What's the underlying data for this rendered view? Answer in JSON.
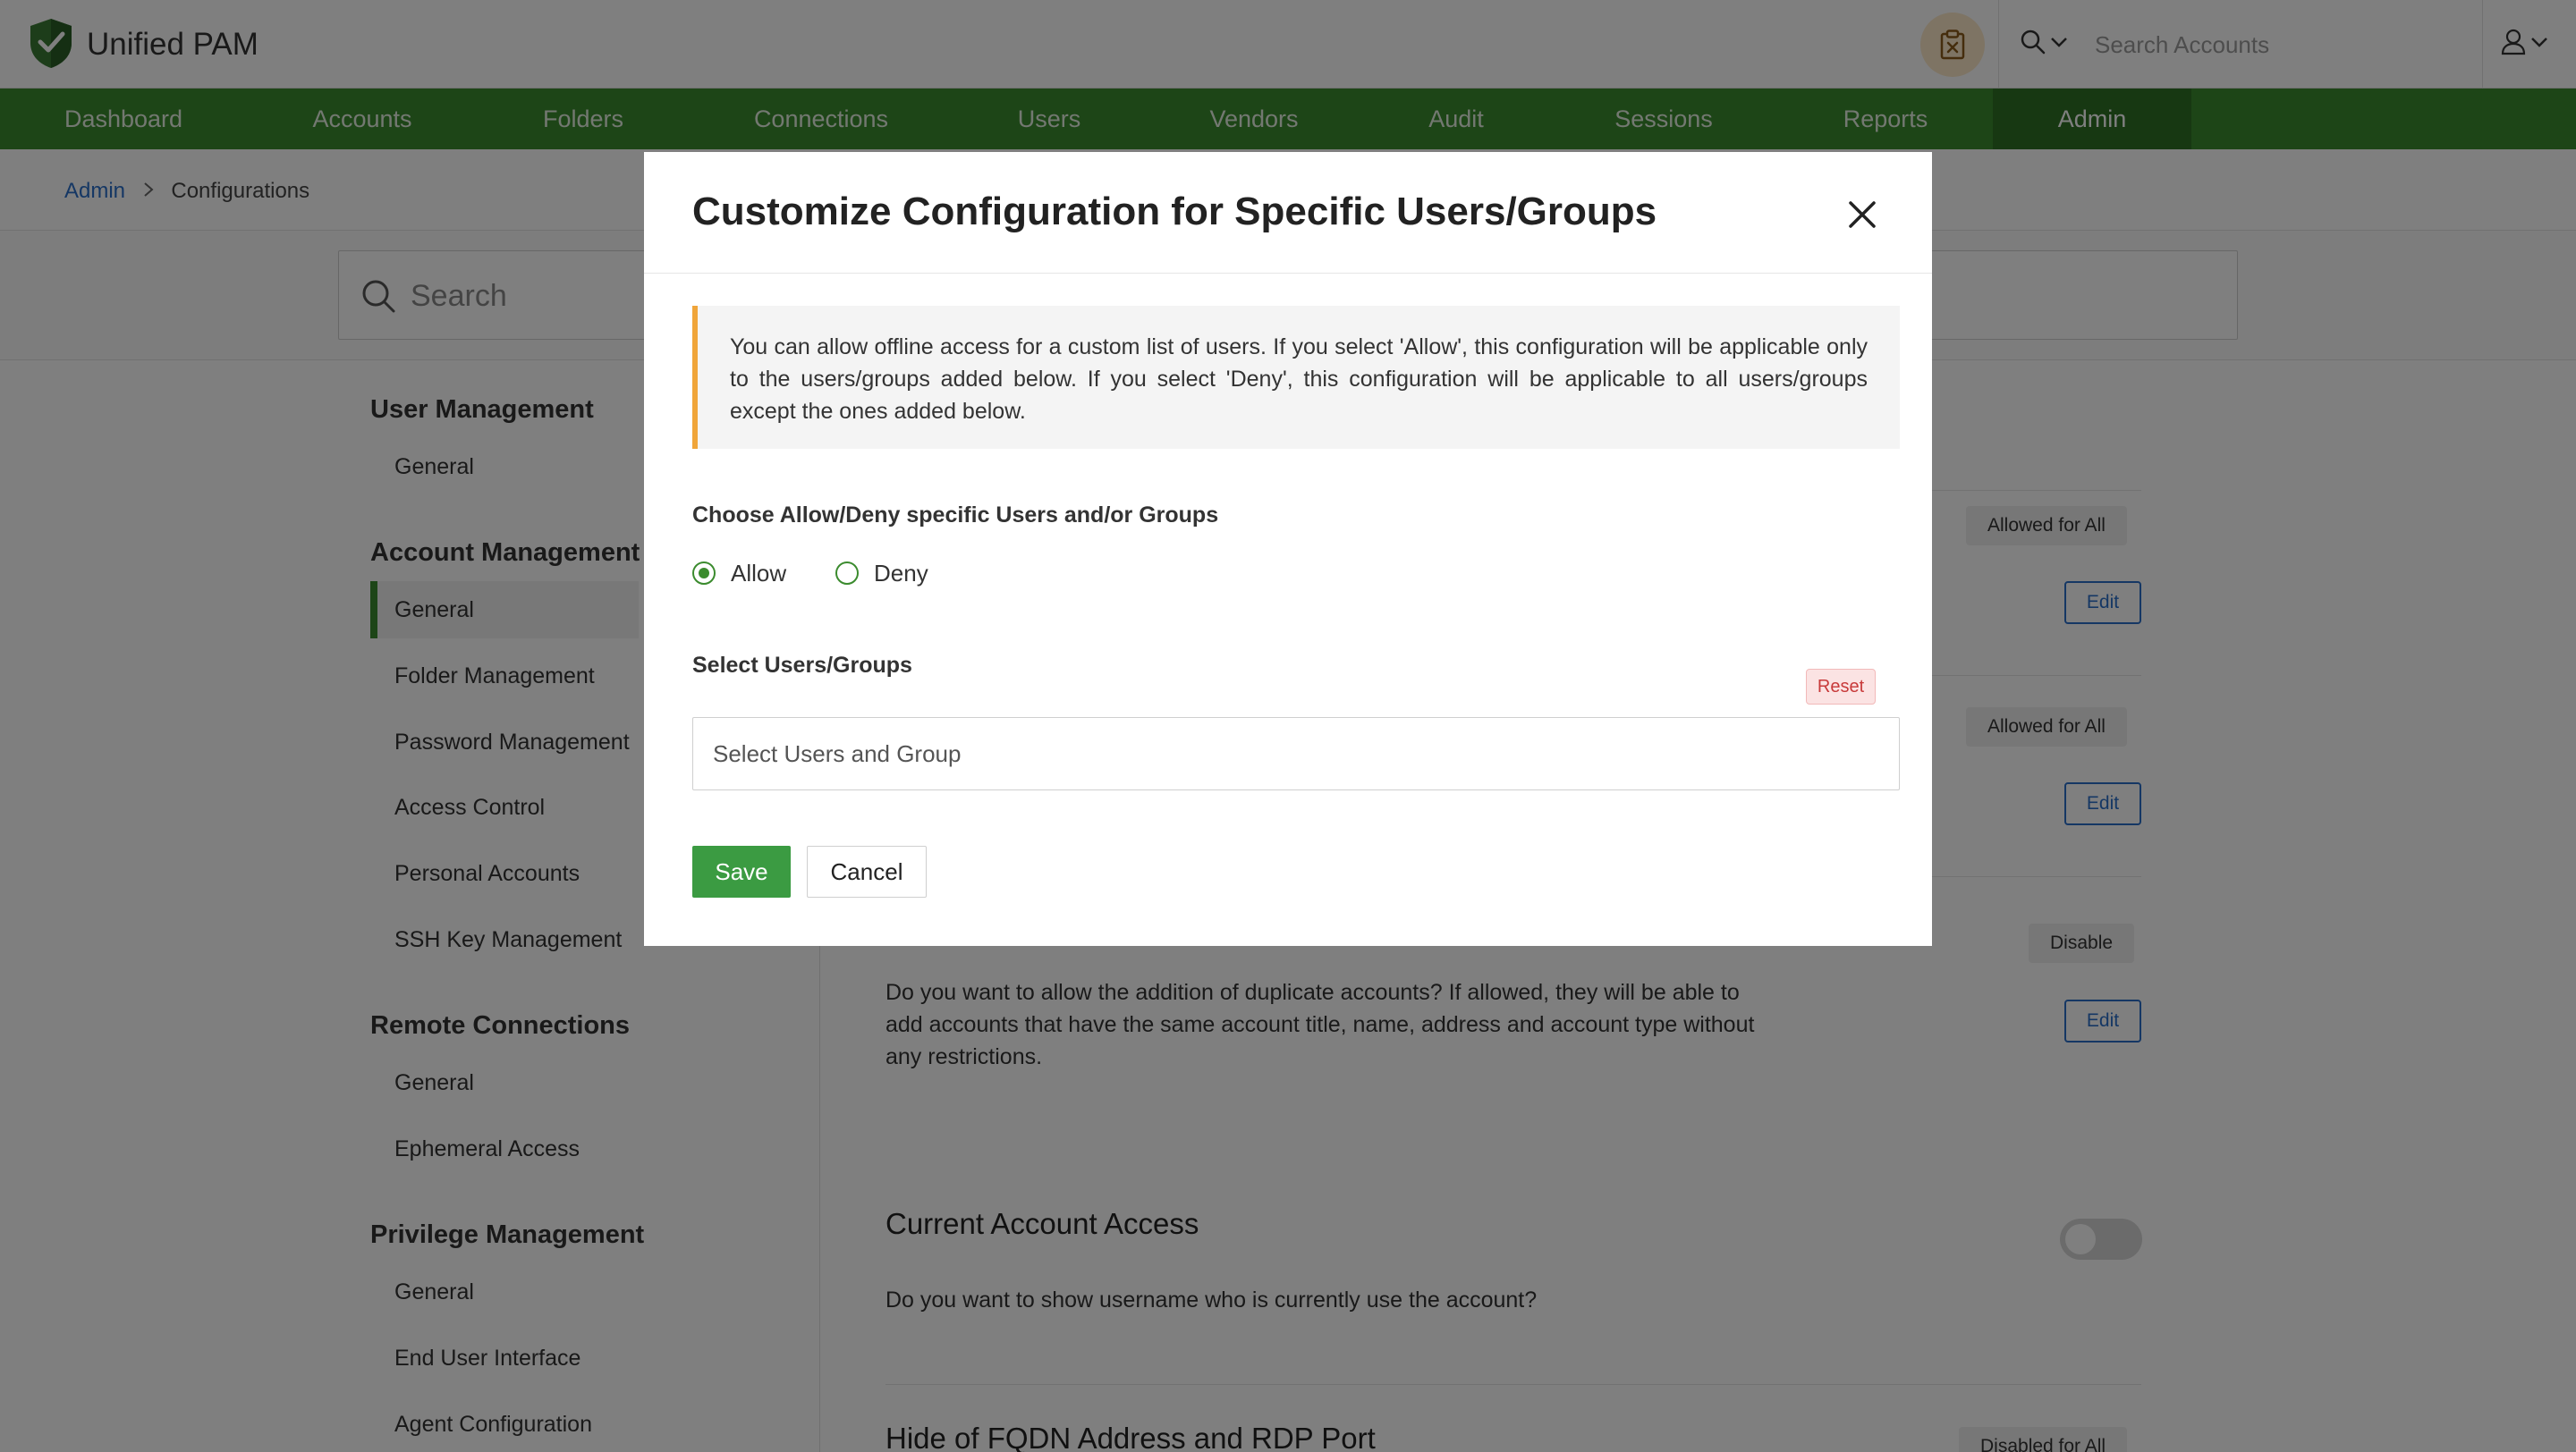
{
  "app": {
    "title": "Unified PAM"
  },
  "header": {
    "search_placeholder": "Search Accounts"
  },
  "nav": {
    "items": [
      "Dashboard",
      "Accounts",
      "Folders",
      "Connections",
      "Users",
      "Vendors",
      "Audit",
      "Sessions",
      "Reports",
      "Admin"
    ],
    "active": "Admin"
  },
  "breadcrumb": {
    "root": "Admin",
    "current": "Configurations"
  },
  "search": {
    "placeholder": "Search"
  },
  "sidebar": {
    "sections": [
      {
        "title": "User Management",
        "items": [
          "General"
        ]
      },
      {
        "title": "Account Management",
        "items": [
          "General",
          "Folder Management",
          "Password Management",
          "Access Control",
          "Personal Accounts",
          "SSH Key Management"
        ]
      },
      {
        "title": "Remote Connections",
        "items": [
          "General",
          "Ephemeral Access"
        ]
      },
      {
        "title": "Privilege Management",
        "items": [
          "General",
          "End User Interface",
          "Agent Configuration"
        ]
      }
    ],
    "active_item": "Account Management / General"
  },
  "main": {
    "rows": [
      {
        "status": "Allowed for All",
        "edit_label": "Edit"
      },
      {
        "status": "Allowed for All",
        "edit_label": "Edit"
      },
      {
        "status": "Disable",
        "edit_label": "Edit",
        "description": "Do you want to allow the addition of duplicate accounts? If allowed, they will be able to add accounts that have the same account title, name, address and account type without any restrictions."
      },
      {
        "title": "Current Account Access",
        "description": "Do you want to show username who is currently use the account?",
        "toggle_on": false
      },
      {
        "title": "Hide of FQDN Address and RDP Port",
        "status": "Disabled for All"
      }
    ]
  },
  "modal": {
    "title": "Customize Configuration for Specific Users/Groups",
    "info": "You can allow offline access for a custom list of users. If you select 'Allow', this configuration will be applicable only to the users/groups added below. If you select 'Deny', this configuration will be applicable to all users/groups except the ones added below.",
    "choose_label": "Choose Allow/Deny specific Users and/or Groups",
    "options": {
      "allow": "Allow",
      "deny": "Deny",
      "selected": "Allow"
    },
    "select_label": "Select Users/Groups",
    "reset_label": "Reset",
    "select_placeholder": "Select Users and Group",
    "save_label": "Save",
    "cancel_label": "Cancel"
  },
  "colors": {
    "brand_green": "#3b8b2e",
    "link_blue": "#2a6fc9",
    "warning_orange": "#f0a53a",
    "reset_red": "#c83a3a"
  },
  "icons": [
    "shield-check-icon",
    "clipboard-icon",
    "search-icon",
    "chevron-down-icon",
    "user-icon",
    "chevron-right-icon",
    "close-icon"
  ]
}
